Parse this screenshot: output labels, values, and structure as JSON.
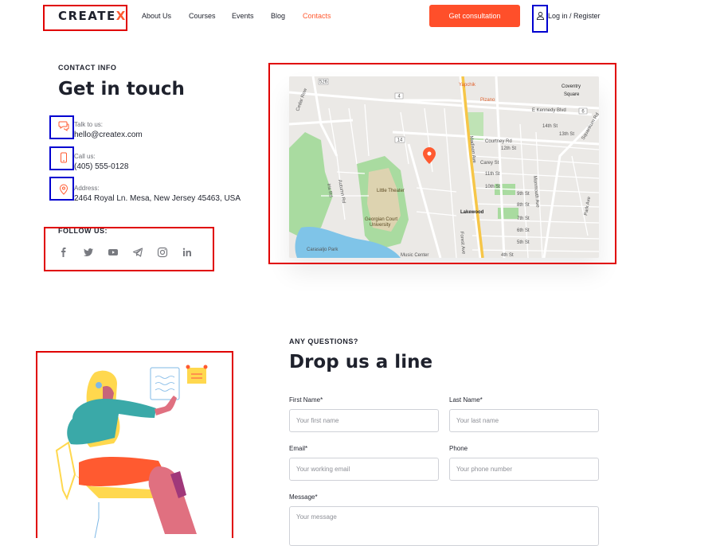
{
  "header": {
    "logo_text": "CREATE",
    "logo_x": "X",
    "nav": [
      "About Us",
      "Courses",
      "Events",
      "Blog",
      "Contacts"
    ],
    "active_nav": "Contacts",
    "cta_label": "Get consultation",
    "login_label": "Log in / Register"
  },
  "contact": {
    "eyebrow": "CONTACT INFO",
    "title": "Get in touch",
    "items": [
      {
        "label": "Talk to us:",
        "value": "hello@createx.com",
        "icon": "chat-icon"
      },
      {
        "label": "Call us:",
        "value": "(405) 555-0128",
        "icon": "phone-icon"
      },
      {
        "label": "Address:",
        "value": "2464 Royal Ln. Mesa, New Jersey 45463, USA",
        "icon": "location-pin-icon"
      }
    ],
    "follow_label": "FOLLOW US:",
    "socials": [
      "facebook-icon",
      "twitter-icon",
      "youtube-icon",
      "telegram-icon",
      "instagram-icon",
      "linkedin-icon"
    ]
  },
  "map": {
    "labels": {
      "coventry": "Coventry",
      "square": "Square",
      "yapchik": "Yapchik",
      "pizano": "Pizano",
      "kennedy": "E Kennedy Blvd",
      "cedar": "Cedar Row",
      "little_theater": "Little Theater",
      "georgian": "Georgian Court",
      "university": "University",
      "lakewood": "Lakewood",
      "carasaljo": "Carasaljo Park",
      "music_center": "Music Center",
      "madison": "Madison Ave",
      "forest": "Forest Ave",
      "monmouth": "Monmouth Ave",
      "park": "Park Ave",
      "squankum": "Squankum Rd",
      "courtney": "Courtney Rd",
      "carey": "Carey St",
      "st14": "14th St",
      "st13": "13th St",
      "st12": "12th St",
      "st11": "11th St",
      "st10": "10th St",
      "st9": "9th St",
      "st8": "8th St",
      "st7": "7th St",
      "st6": "6th St",
      "st5": "5th St",
      "st4": "4th St",
      "iris": "Iris Rd",
      "autumn": "Autumn Rd",
      "r526": "526",
      "r4": "4",
      "r14": "14",
      "r6": "6"
    }
  },
  "form": {
    "eyebrow": "ANY QUESTIONS?",
    "title": "Drop us a line",
    "first_name_label": "First Name*",
    "first_name_placeholder": "Your first name",
    "last_name_label": "Last  Name*",
    "last_name_placeholder": "Your last name",
    "email_label": "Email*",
    "email_placeholder": "Your working email",
    "phone_label": "Phone",
    "phone_placeholder": "Your phone number",
    "message_label": "Message*",
    "message_placeholder": "Your message"
  },
  "colors": {
    "accent": "#ff5a30",
    "dark": "#1e212c",
    "annotation_red": "#e00000",
    "annotation_blue": "#0000d0"
  }
}
